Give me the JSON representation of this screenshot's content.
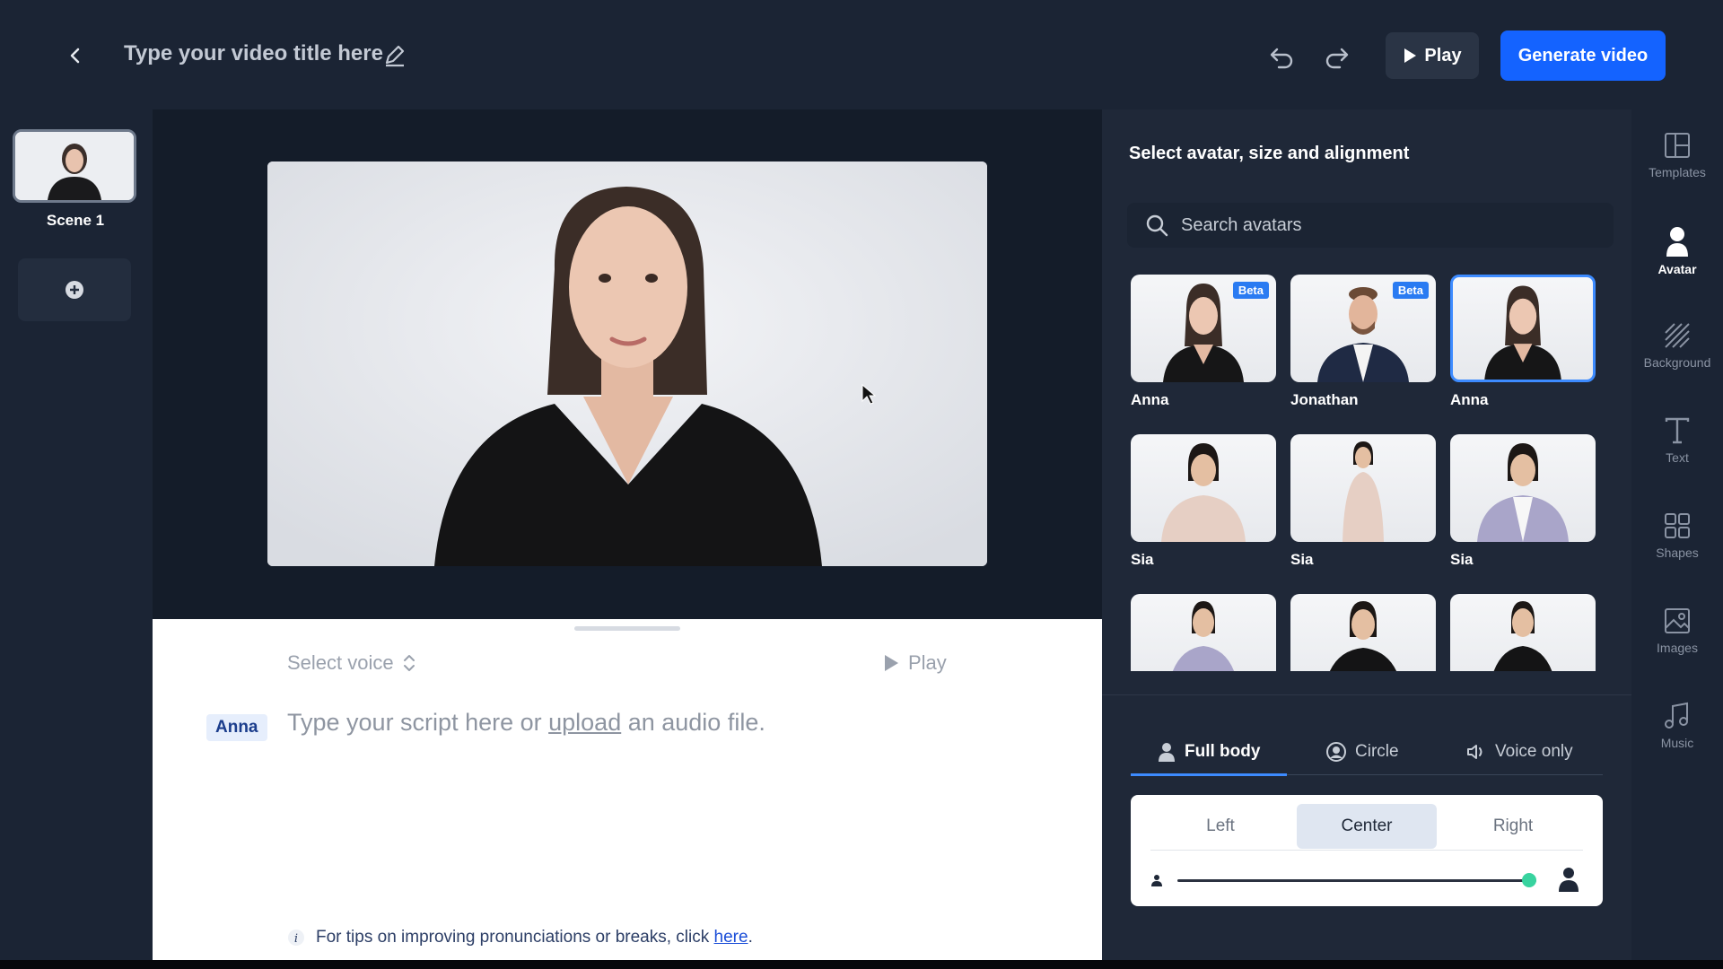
{
  "header": {
    "video_title": "Type your video title here",
    "play_label": "Play",
    "generate_label": "Generate video"
  },
  "scenes": {
    "items": [
      {
        "label": "Scene 1"
      }
    ]
  },
  "script": {
    "select_voice": "Select voice",
    "play_label": "Play",
    "speaker": "Anna",
    "placeholder_before": "Type your script here or ",
    "placeholder_link": "upload",
    "placeholder_after": " an audio file.",
    "tips_before": "For tips on improving pronunciations or breaks, click ",
    "tips_link": "here",
    "tips_after": "."
  },
  "avatar_panel": {
    "title": "Select avatar, size and alignment",
    "search_placeholder": "Search avatars",
    "avatars": [
      {
        "name": "Anna",
        "badge": "Beta"
      },
      {
        "name": "Jonathan",
        "badge": "Beta"
      },
      {
        "name": "Anna",
        "badge": ""
      },
      {
        "name": "Sia",
        "badge": ""
      },
      {
        "name": "Sia",
        "badge": ""
      },
      {
        "name": "Sia",
        "badge": ""
      },
      {
        "name": "",
        "badge": ""
      },
      {
        "name": "",
        "badge": ""
      },
      {
        "name": "",
        "badge": ""
      }
    ],
    "modes": [
      "Full body",
      "Circle",
      "Voice only"
    ],
    "active_mode": "Full body",
    "alignments": [
      "Left",
      "Center",
      "Right"
    ],
    "active_alignment": "Center",
    "size_fraction": 0.98
  },
  "side_nav": [
    "Templates",
    "Avatar",
    "Background",
    "Text",
    "Shapes",
    "Images",
    "Music"
  ],
  "colors": {
    "accent": "#1463ff",
    "panel_bg": "#1f2838",
    "app_bg": "#1b2434",
    "slider_thumb": "#38d39f"
  }
}
